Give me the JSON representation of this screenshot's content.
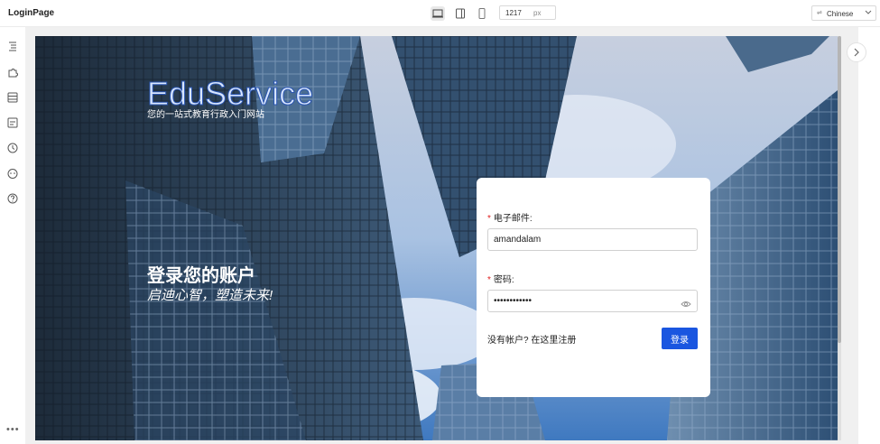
{
  "app": {
    "title": "LoginPage"
  },
  "toolbar": {
    "width_value": "1217",
    "width_unit": "px",
    "language": "Chinese",
    "devices": [
      "desktop-icon",
      "tablet-icon",
      "mobile-icon"
    ]
  },
  "sidebar": {
    "icons": [
      "outline-icon",
      "puzzle-icon",
      "database-icon",
      "media-icon",
      "history-icon",
      "bot-icon",
      "help-icon"
    ],
    "more": "•••"
  },
  "page": {
    "brand": "EduService",
    "tagline": "您的一站式教育行政入门网站",
    "hero_title": "登录您的账户",
    "hero_subtitle": "启迪心智，塑造未来!"
  },
  "form": {
    "email_label": "电子邮件:",
    "email_value": "amandalam",
    "password_label": "密码:",
    "password_value": "••••••••••••",
    "required_mark": "*",
    "signup_text": "没有帐户? 在这里注册",
    "login_label": "登录"
  },
  "colors": {
    "primary": "#1a56e0",
    "required": "#e02020",
    "brand_stroke": "#2a55b0"
  }
}
